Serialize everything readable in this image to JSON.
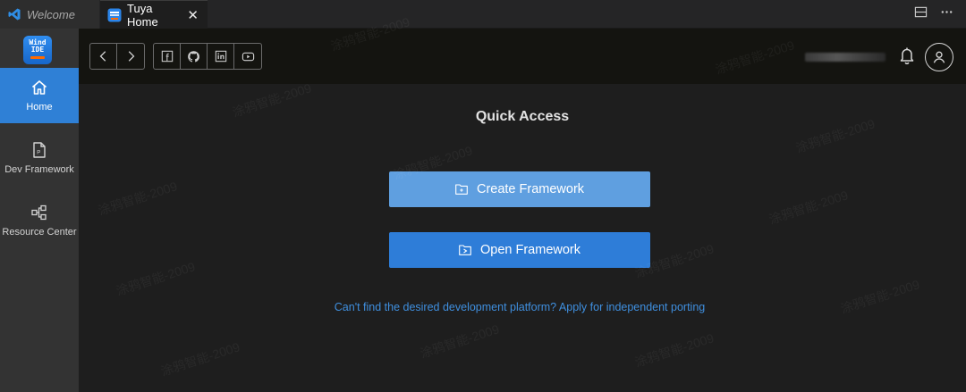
{
  "tabs": [
    {
      "label": "Welcome",
      "icon": "vscode-icon",
      "active": false
    },
    {
      "label": "Tuya Home",
      "icon": "wind-ide-icon",
      "active": true
    }
  ],
  "tabbar_actions": [
    "split-editor-icon",
    "more-icon"
  ],
  "sidebar": {
    "logo": {
      "line1": "Wind",
      "line2": "IDE"
    },
    "items": [
      {
        "label": "Home",
        "icon": "home-icon",
        "active": true
      },
      {
        "label": "Dev Framework",
        "icon": "file-icon",
        "active": false
      },
      {
        "label": "Resource Center",
        "icon": "resource-icon",
        "active": false
      }
    ]
  },
  "toolbar": {
    "nav_buttons": [
      "back-icon",
      "forward-icon"
    ],
    "social_buttons": [
      "facebook-icon",
      "github-icon",
      "linkedin-icon",
      "youtube-icon"
    ]
  },
  "main": {
    "title": "Quick Access",
    "create_label": "Create Framework",
    "open_label": "Open Framework",
    "porting_link": "Can't find the desired development platform? Apply for independent porting"
  },
  "watermark_text": "涂鸦智能-2009",
  "colors": {
    "accent": "#2f80d6",
    "create_button": "#5f9fe0",
    "open_button": "#2e7dd8",
    "link": "#3f8fdf"
  }
}
